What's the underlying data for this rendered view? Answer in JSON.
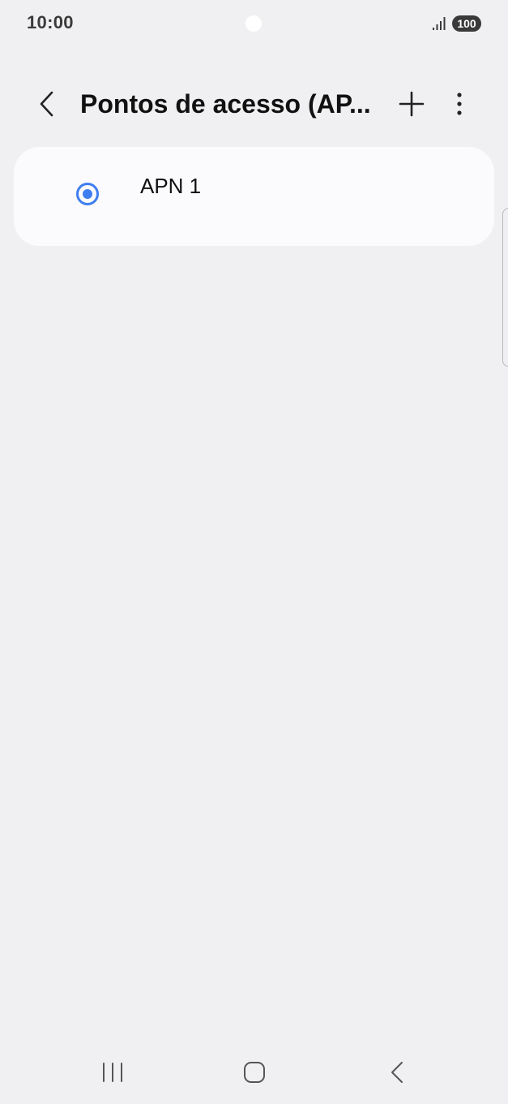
{
  "status_bar": {
    "time": "10:00",
    "battery": "100",
    "signal_icon": "signal-bars-icon"
  },
  "app_bar": {
    "title": "Pontos de acesso (AP...",
    "back_icon": "chevron-left-icon",
    "add_icon": "plus-icon",
    "more_icon": "more-vertical-icon"
  },
  "apn_list": {
    "items": [
      {
        "label": "APN 1",
        "selected": true
      }
    ]
  },
  "nav_bar": {
    "recents_icon": "recents-icon",
    "home_icon": "home-icon",
    "back_icon": "back-icon"
  },
  "colors": {
    "accent": "#3f7ef0",
    "background": "#f0f0f2",
    "card": "#fbfbfd"
  }
}
